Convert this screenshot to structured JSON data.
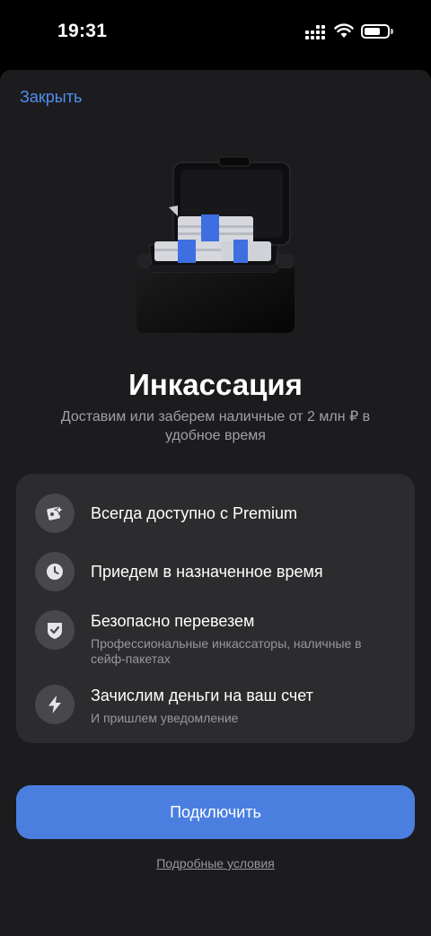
{
  "status_bar": {
    "time": "19:31"
  },
  "header": {
    "close_label": "Закрыть"
  },
  "hero": {
    "title": "Инкассация",
    "subtitle": "Доставим или заберем наличные от 2 млн ₽ в удобное время"
  },
  "features": [
    {
      "icon": "premium-star-icon",
      "title": "Всегда доступно с Premium",
      "desc": ""
    },
    {
      "icon": "clock-icon",
      "title": "Приедем в назначенное время",
      "desc": ""
    },
    {
      "icon": "shield-check-icon",
      "title": "Безопасно перевезем",
      "desc": "Профессиональные инкассаторы, наличные в сейф-пакетах"
    },
    {
      "icon": "lightning-icon",
      "title": "Зачислим деньги на ваш счет",
      "desc": "И пришлем уведомление"
    }
  ],
  "actions": {
    "connect_label": "Подключить",
    "terms_label": "Подробные условия"
  },
  "colors": {
    "accent": "#4a7fe0",
    "link": "#4f8ef0",
    "sheet": "#1c1c1e",
    "card": "#2c2c2e"
  }
}
